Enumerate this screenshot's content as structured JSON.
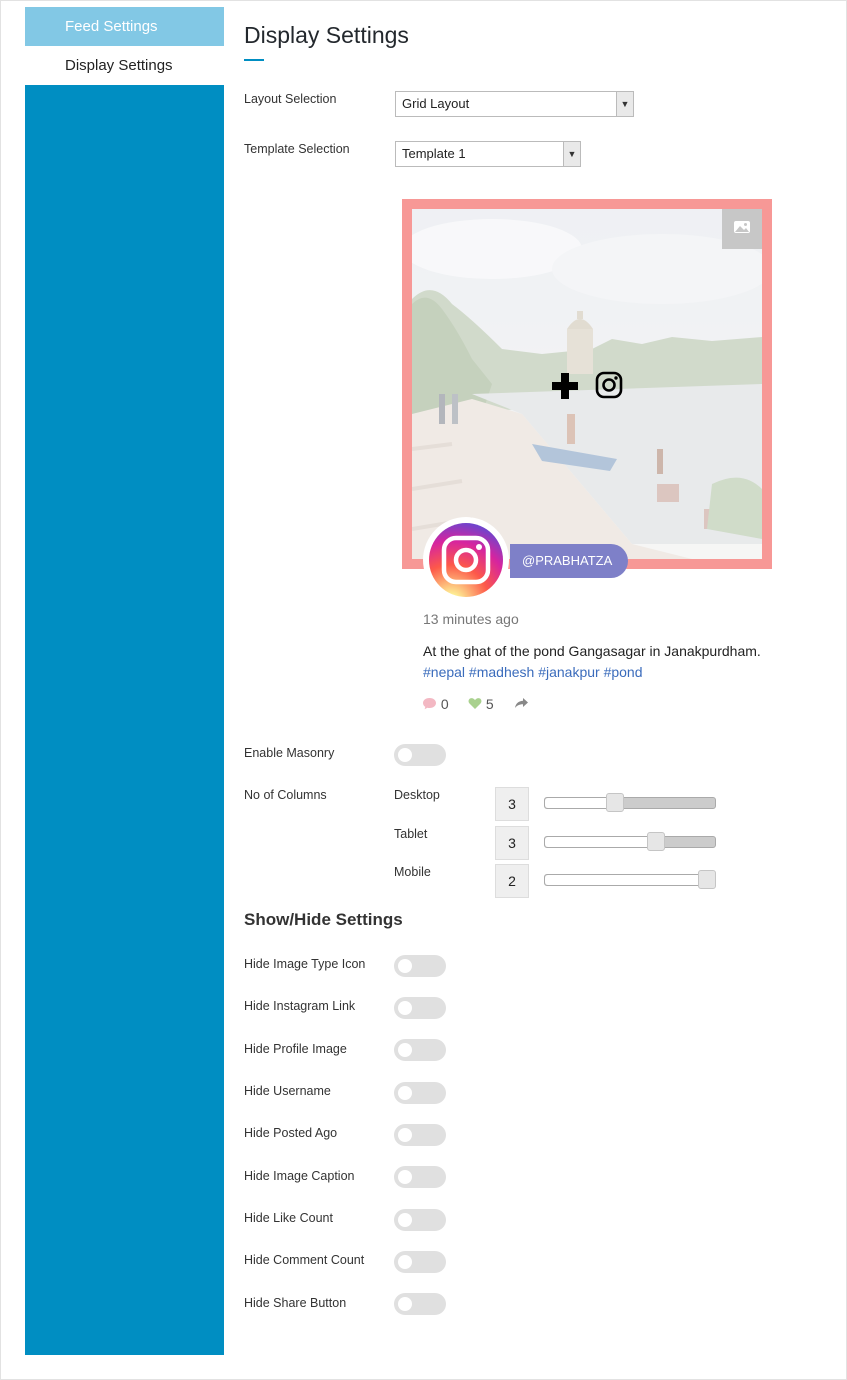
{
  "sidebar": {
    "tabs": [
      {
        "label": "Feed Settings",
        "active": false
      },
      {
        "label": "Display Settings",
        "active": true
      }
    ],
    "color": "#008ec2"
  },
  "page_title": "Display Settings",
  "layout_selection": {
    "label": "Layout Selection",
    "value": "Grid Layout"
  },
  "template_selection": {
    "label": "Template Selection",
    "value": "Template 1"
  },
  "preview": {
    "username": "@PRABHATZA",
    "posted_ago": "13 minutes ago",
    "caption_text": "At the ghat of the pond Gangasagar in Janakpurdham.",
    "caption_tags": "#nepal #madhesh #janakpur #pond",
    "comment_count": "0",
    "like_count": "5",
    "icons": {
      "add": "plus-icon",
      "instagram": "instagram-icon",
      "image_type": "image-icon",
      "comment": "comment-icon",
      "like": "heart-icon",
      "share": "share-icon"
    },
    "border_color": "#f79896",
    "username_color": "#7e80c8"
  },
  "masonry": {
    "label": "Enable Masonry",
    "enabled": false
  },
  "columns": {
    "label": "No of Columns",
    "devices": [
      {
        "label": "Desktop",
        "value": "3",
        "slider_fraction": 0.4
      },
      {
        "label": "Tablet",
        "value": "3",
        "slider_fraction": 0.67
      },
      {
        "label": "Mobile",
        "value": "2",
        "slider_fraction": 1.0
      }
    ]
  },
  "show_hide": {
    "title": "Show/Hide Settings",
    "items": [
      {
        "label": "Hide Image Type Icon",
        "enabled": false
      },
      {
        "label": "Hide Instagram Link",
        "enabled": false
      },
      {
        "label": "Hide Profile Image",
        "enabled": false
      },
      {
        "label": "Hide Username",
        "enabled": false
      },
      {
        "label": "Hide Posted Ago",
        "enabled": false
      },
      {
        "label": "Hide Image Caption",
        "enabled": false
      },
      {
        "label": "Hide Like Count",
        "enabled": false
      },
      {
        "label": "Hide Comment Count",
        "enabled": false
      },
      {
        "label": "Hide Share Button",
        "enabled": false
      }
    ]
  }
}
